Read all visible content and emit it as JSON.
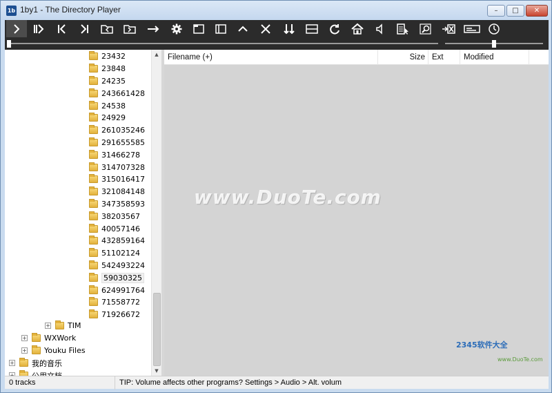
{
  "window": {
    "title": "1by1 - The Directory Player",
    "app_icon_glyph": "1b",
    "minimize_label": "–",
    "maximize_label": "□",
    "close_label": "✕"
  },
  "toolbar": {
    "buttons": [
      {
        "name": "play-icon"
      },
      {
        "name": "play-next-icon"
      },
      {
        "name": "previous-track-icon"
      },
      {
        "name": "next-track-icon"
      },
      {
        "name": "previous-folder-icon"
      },
      {
        "name": "next-folder-icon"
      },
      {
        "name": "follow-arrow-icon"
      },
      {
        "name": "settings-gear-icon"
      },
      {
        "name": "window-layout-icon"
      },
      {
        "name": "sidebar-toggle-icon"
      },
      {
        "name": "collapse-up-icon"
      },
      {
        "name": "close-x-icon"
      },
      {
        "name": "sort-icon"
      },
      {
        "name": "panel-split-icon"
      },
      {
        "name": "refresh-icon"
      },
      {
        "name": "home-icon"
      },
      {
        "name": "volume-icon"
      },
      {
        "name": "playlist-select-icon"
      },
      {
        "name": "search-icon"
      },
      {
        "name": "remove-icon"
      },
      {
        "name": "keyboard-icon"
      },
      {
        "name": "clock-icon"
      }
    ]
  },
  "tree": {
    "folders": [
      "23432",
      "23848",
      "24235",
      "243661428",
      "24538",
      "24929",
      "261035246",
      "291655585",
      "31466278",
      "314707328",
      "315016417",
      "321084148",
      "347358593",
      "38203567",
      "40057146",
      "432859164",
      "51102124",
      "542493224",
      "59030325",
      "624991764",
      "71558772",
      "71926672"
    ],
    "selected_folder": "59030325",
    "tim": "TIM",
    "wxwork": "WXWork",
    "youku": "Youku Files",
    "my_music": "我的音乐",
    "public_docs": "公用文档",
    "expand_glyph": "+",
    "scroll_up": "▲",
    "scroll_down": "▼"
  },
  "filelist": {
    "columns": [
      {
        "label": "Filename (+)"
      },
      {
        "label": "Size"
      },
      {
        "label": "Ext"
      },
      {
        "label": "Modified"
      }
    ],
    "rows": []
  },
  "watermark": {
    "main": "www.DuoTe.com",
    "corner": "2345软件大全",
    "corner_url": "www.DuoTe.com"
  },
  "status": {
    "tracks": "0 tracks",
    "tip": "TIP: Volume affects other programs? Settings > Audio > Alt. volum"
  }
}
